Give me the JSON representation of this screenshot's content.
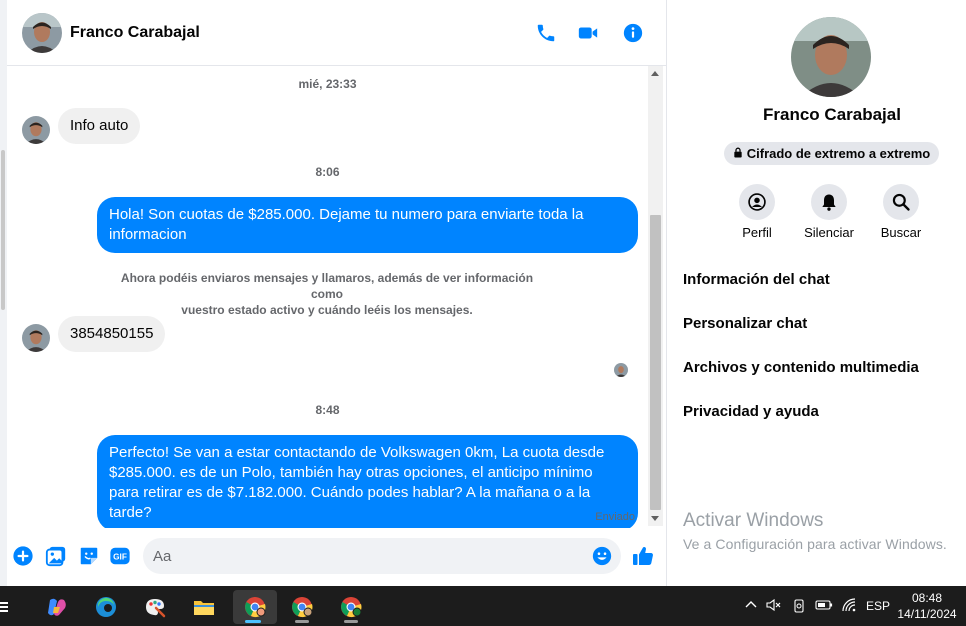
{
  "contact": {
    "name": "Franco Carabajal"
  },
  "colors": {
    "accent": "#0084ff",
    "bubble_in": "#f0f0f0",
    "taskbar": "#1c1c1c"
  },
  "icons": {
    "call": "phone-icon",
    "video": "video-camera-icon",
    "info": "info-icon",
    "add": "plus-circle-icon",
    "image": "image-icon",
    "sticker": "sticker-icon",
    "gif": "gif-icon",
    "emoji": "emoji-icon",
    "like": "thumbs-up-icon"
  },
  "messages": {
    "ts1": "mié, 23:33",
    "in1": "Info auto",
    "ts2": "8:06",
    "out1": "Hola! Son cuotas de $285.000. Dejame tu numero para enviarte toda la informacion",
    "notice_line1": "Ahora podéis enviaros mensajes y llamaros, además de ver información como",
    "notice_line2": "vuestro estado activo y cuándo leéis los mensajes.",
    "in2": "3854850155",
    "ts3": "8:48",
    "out2": "Perfecto!  Se van a estar contactando de Volkswagen 0km, La cuota desde $285.000. es de un Polo, también hay otras opciones, el anticipo mínimo para retirar es de $7.182.000. Cuándo podes hablar? A la mañana o a la tarde?",
    "status": "Enviado"
  },
  "composer": {
    "placeholder": "Aa",
    "gif_label": "GIF"
  },
  "info_pane": {
    "name": "Franco Carabajal",
    "encryption": "Cifrado de extremo a extremo",
    "actions": [
      "Perfil",
      "Silenciar",
      "Buscar"
    ],
    "menu": [
      "Información del chat",
      "Personalizar chat",
      "Archivos y contenido multimedia",
      "Privacidad y ayuda"
    ]
  },
  "watermark": {
    "title": "Activar Windows",
    "subtitle": "Ve a Configuración para activar Windows."
  },
  "taskbar": {
    "lang": "ESP",
    "time": "08:48",
    "date": "14/11/2024"
  }
}
